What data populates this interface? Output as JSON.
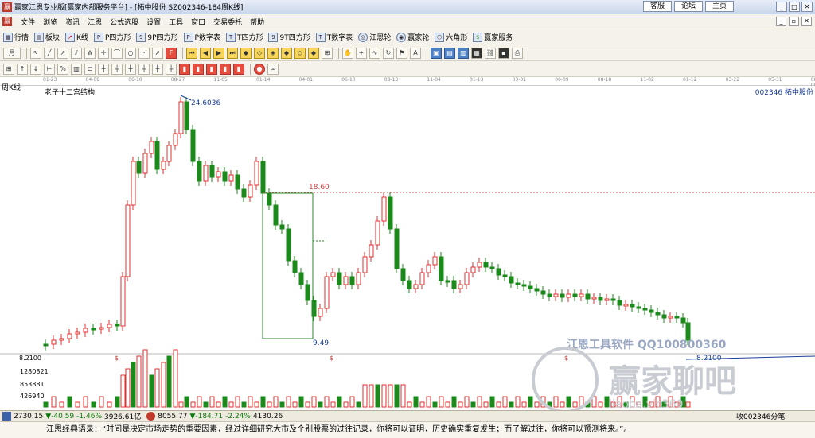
{
  "window": {
    "title": "赢家江恩专业版[赢家内部服务平台] - [柘中股份  SZ002346-184周K线]",
    "links": [
      "客服",
      "论坛",
      "主页"
    ]
  },
  "menu": [
    "文件",
    "浏览",
    "资讯",
    "江恩",
    "公式选股",
    "设置",
    "工具",
    "窗口",
    "交易委托",
    "帮助"
  ],
  "toolbar1": [
    {
      "label": "行情",
      "icon": "grid-icon"
    },
    {
      "label": "板块",
      "icon": "blocks-icon"
    },
    {
      "label": "K线",
      "icon": "kline-icon"
    },
    {
      "label": "P四方形",
      "icon": "p-square-icon"
    },
    {
      "label": "9P四方形",
      "icon": "9p-square-icon"
    },
    {
      "label": "P数字表",
      "icon": "p-table-icon"
    },
    {
      "label": "T四方形",
      "icon": "t-square-icon"
    },
    {
      "label": "9T四方形",
      "icon": "9t-square-icon"
    },
    {
      "label": "T数字表",
      "icon": "t-table-icon"
    },
    {
      "label": "江恩轮",
      "icon": "gann-wheel-icon"
    },
    {
      "label": "赢家轮",
      "icon": "winner-wheel-icon"
    },
    {
      "label": "六角形",
      "icon": "hexagon-icon"
    },
    {
      "label": "赢家服务",
      "icon": "dollar-icon"
    }
  ],
  "toolbar2_lead": "月",
  "chart_panel": {
    "period_label": "周K线",
    "title": "老子十二宫结构",
    "stock": "002346  柘中股份",
    "dates": [
      "01-23",
      "04-08",
      "06-10",
      "08-27",
      "11-05",
      "01-14",
      "04-01",
      "06-10",
      "08-13",
      "11-04",
      "01-13",
      "03-31",
      "06-09",
      "08-18",
      "11-02",
      "01-12",
      "03-22",
      "05-31",
      "08-08"
    ],
    "annotations": {
      "high": "24.6036",
      "mid": "18.60",
      "low_box": "9.49",
      "last": "8.2100"
    },
    "volume_ticks": [
      "1280821",
      "853881",
      "426940"
    ],
    "left_price": "8.2100",
    "watermark": {
      "line1": "江恩工具软件  QQ100800360",
      "line2": "赢家聊吧",
      "line3": "liaoba.vic360"
    }
  },
  "status": {
    "idx1_val": "2730.15",
    "idx1_chg": "▼-40.59",
    "idx1_pct": "-1.46%",
    "idx1_amt": "3926.61亿",
    "idx2_val": "8055.77",
    "idx2_chg": "▼-184.71",
    "idx2_pct": "-2.24%",
    "idx2_amt": "4130.26",
    "right_text": "收002346分笔"
  },
  "quote": "江恩经典语录：“时间是决定市场走势的重要因素，经过详细研究大市及个别股票的过往记录，你将可以证明，历史确实重复发生；而了解过往，你将可以预测将来。”。"
}
